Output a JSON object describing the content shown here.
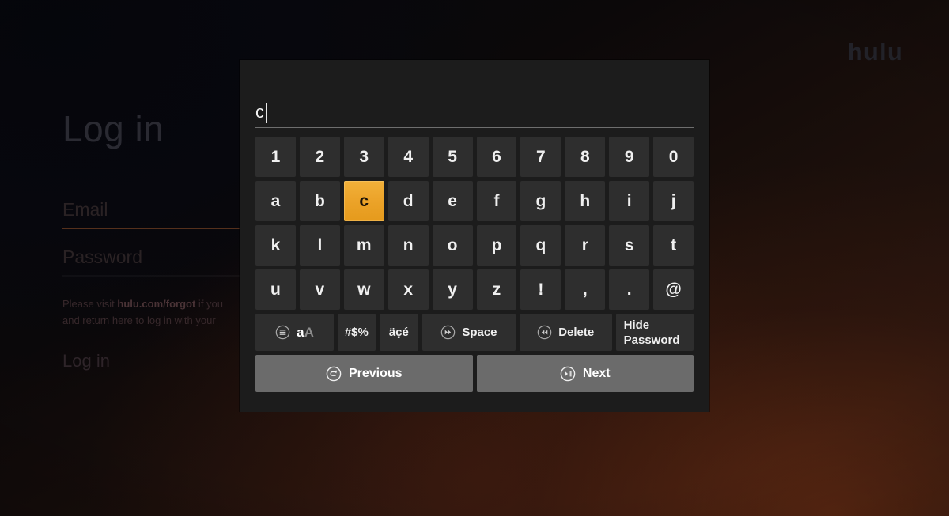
{
  "app": {
    "brand_logo": "hulu",
    "background_accent": "#7a3412"
  },
  "login_screen": {
    "title": "Log in",
    "fields": [
      {
        "label": "Email",
        "state": "focused"
      },
      {
        "label": "Password",
        "state": "idle"
      }
    ],
    "helper_prefix": "Please visit ",
    "helper_link": "hulu.com/forgot",
    "helper_suffix": " if you",
    "helper_line2": "and return here to log in with your",
    "login_button": "Log in"
  },
  "keyboard": {
    "input_value": "c",
    "input_placeholder": "",
    "selected_key": "c",
    "selected_color": "#eca42a",
    "rows": [
      [
        "1",
        "2",
        "3",
        "4",
        "5",
        "6",
        "7",
        "8",
        "9",
        "0"
      ],
      [
        "a",
        "b",
        "c",
        "d",
        "e",
        "f",
        "g",
        "h",
        "i",
        "j"
      ],
      [
        "k",
        "l",
        "m",
        "n",
        "o",
        "p",
        "q",
        "r",
        "s",
        "t"
      ],
      [
        "u",
        "v",
        "w",
        "x",
        "y",
        "z",
        "!",
        ",",
        ".",
        "@"
      ]
    ],
    "function_keys": {
      "case_lower": "a",
      "case_upper": "A",
      "symbols": "#$%",
      "accents": "äçé",
      "space": "Space",
      "delete": "Delete",
      "hide_password_line1": "Hide",
      "hide_password_line2": "Password"
    },
    "nav_keys": {
      "previous": "Previous",
      "next": "Next"
    },
    "icons": {
      "case": "menu-circle-icon",
      "space": "fast-forward-circle-icon",
      "delete": "rewind-circle-icon",
      "previous": "back-circle-icon",
      "next": "play-pause-circle-icon"
    }
  }
}
